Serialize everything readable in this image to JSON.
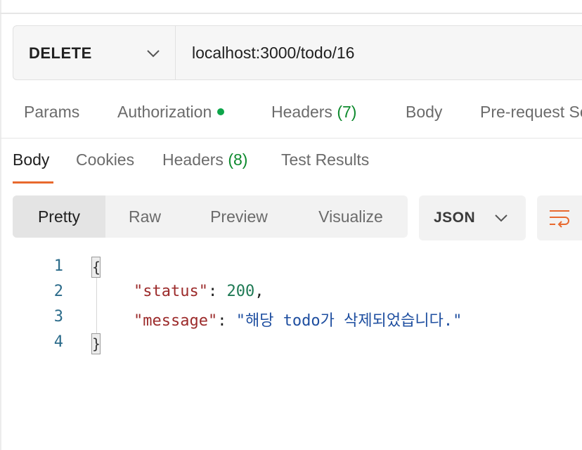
{
  "request": {
    "method": "DELETE",
    "url": "localhost:3000/todo/16"
  },
  "request_tabs": {
    "params": "Params",
    "authorization": "Authorization",
    "headers_label": "Headers",
    "headers_count": "(7)",
    "body": "Body",
    "pre_request": "Pre-request Script"
  },
  "response_tabs": {
    "body": "Body",
    "cookies": "Cookies",
    "headers_label": "Headers",
    "headers_count": "(8)",
    "test_results": "Test Results"
  },
  "view_modes": [
    "Pretty",
    "Raw",
    "Preview",
    "Visualize"
  ],
  "format": "JSON",
  "code": {
    "line_numbers": [
      "1",
      "2",
      "3",
      "4"
    ],
    "open_brace": "{",
    "close_brace": "}",
    "key_status": "\"status\"",
    "value_status": "200",
    "key_message": "\"message\"",
    "value_message": "\"해당 todo가 삭제되었습니다.\"",
    "colon": ": ",
    "comma": ","
  },
  "colors": {
    "accent_tab_underline": "#e8692e",
    "auth_dot": "#0da54a",
    "count_green": "#0e8a2e",
    "json_key": "#9c2b2b",
    "json_number": "#1f7a55",
    "json_string": "#1f4fa0"
  },
  "icons": {
    "method_dropdown": "chevron-down-icon",
    "format_dropdown": "chevron-down-icon",
    "wrap": "wrap-lines-icon",
    "auth_status": "status-dot-icon"
  }
}
